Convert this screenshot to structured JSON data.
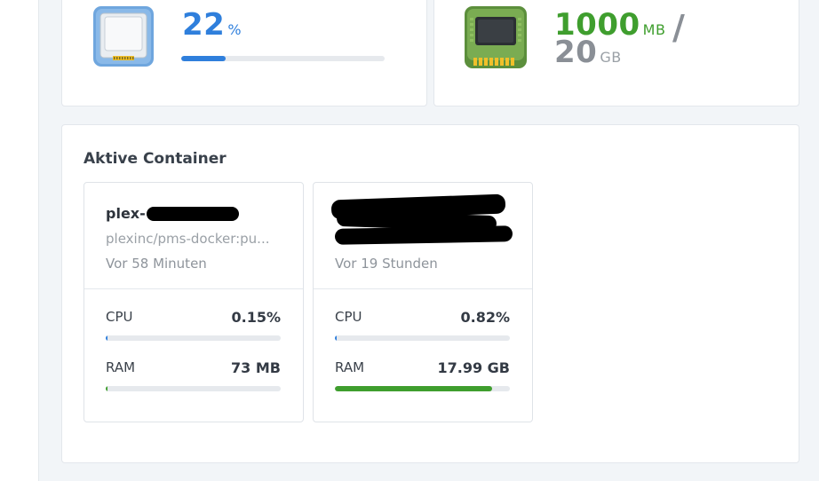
{
  "cpu_widget": {
    "value": "22",
    "unit": "%",
    "usage_fraction": 0.22
  },
  "ram_widget": {
    "used_value": "1000",
    "used_unit": "MB",
    "separator": "/",
    "total_value": "20",
    "total_unit": "GB"
  },
  "containers_section": {
    "title": "Aktive Container",
    "containers": [
      {
        "name": "plex-",
        "image": "plexinc/pms-docker:pu...",
        "uptime": "Vor 58 Minuten",
        "cpu_label": "CPU",
        "cpu_value": "0.15%",
        "cpu_fraction": 0.0015,
        "ram_label": "RAM",
        "ram_value": "73 MB",
        "ram_fraction": 0.004
      },
      {
        "name": "",
        "image": "",
        "uptime": "Vor 19 Stunden",
        "cpu_label": "CPU",
        "cpu_value": "0.82%",
        "cpu_fraction": 0.0082,
        "ram_label": "RAM",
        "ram_value": "17.99 GB",
        "ram_fraction": 0.9
      }
    ]
  },
  "colors": {
    "accent_blue": "#2f7fdc",
    "accent_green": "#3f9e2e",
    "muted_gray": "#8a8f96"
  }
}
